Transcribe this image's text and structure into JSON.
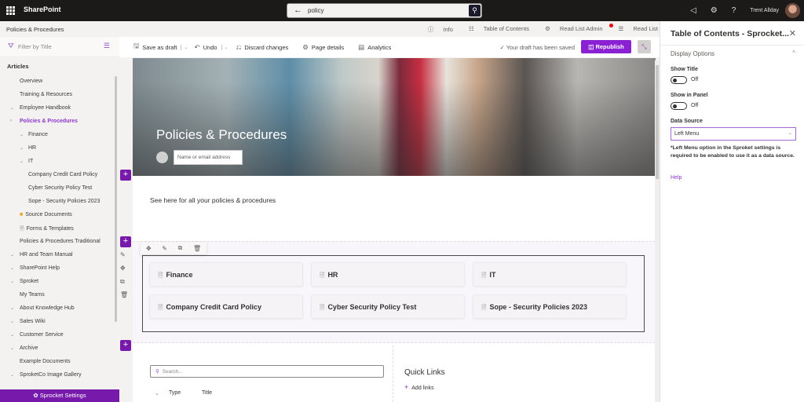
{
  "topbar": {
    "app_name": "SharePoint",
    "search_value": "policy",
    "user_name": "Trent Allday",
    "icons": [
      "waffle-icon",
      "back-arrow-icon",
      "search-icon",
      "megaphone-icon",
      "gear-icon",
      "help-icon",
      "avatar"
    ]
  },
  "sitebar": {
    "site_name": "Policies & Procedures",
    "commands": [
      {
        "icon": "ⓘ",
        "label": "Info"
      },
      {
        "icon": "☷",
        "label": "Table of Contents"
      },
      {
        "icon": "⚙",
        "label": "Read List Admin"
      },
      {
        "icon": "☰",
        "label": "Read List"
      }
    ]
  },
  "leftnav": {
    "filter_placeholder": "Filter by Title",
    "heading": "Articles",
    "items": [
      {
        "label": "Overview",
        "level": 0,
        "chevron": ""
      },
      {
        "label": "Training & Resources",
        "level": 0,
        "chevron": ""
      },
      {
        "label": "Employee Handbook",
        "level": 0,
        "chevron": "⌄"
      },
      {
        "label": "Policies & Procedures",
        "level": 0,
        "chevron": "›",
        "active": true
      },
      {
        "label": "Finance",
        "level": 1,
        "chevron": "⌄"
      },
      {
        "label": "HR",
        "level": 1,
        "chevron": "⌄"
      },
      {
        "label": "IT",
        "level": 1,
        "chevron": "⌄"
      },
      {
        "label": "Company Credit Card Policy",
        "level": 2,
        "chevron": ""
      },
      {
        "label": "Cyber Security Policy Test",
        "level": 2,
        "chevron": ""
      },
      {
        "label": "Sope - Security Policies 2023",
        "level": 2,
        "chevron": ""
      },
      {
        "label": "Source Documents",
        "level": 1,
        "chevron": "",
        "icon": "folder"
      },
      {
        "label": "Forms & Templates",
        "level": 1,
        "chevron": "",
        "icon": "doc"
      },
      {
        "label": "Policies & Procedures Traditional",
        "level": 0,
        "chevron": ""
      },
      {
        "label": "HR and Team Manual",
        "level": 0,
        "chevron": "⌄"
      },
      {
        "label": "SharePoint Help",
        "level": 0,
        "chevron": "⌄"
      },
      {
        "label": "Sproket",
        "level": 0,
        "chevron": "⌄"
      },
      {
        "label": "My Teams",
        "level": 0,
        "chevron": ""
      },
      {
        "label": "About Knowledge Hub",
        "level": 0,
        "chevron": "⌄"
      },
      {
        "label": "Sales Wiki",
        "level": 0,
        "chevron": "⌄"
      },
      {
        "label": "Customer Service",
        "level": 0,
        "chevron": "⌄"
      },
      {
        "label": "Archive",
        "level": 0,
        "chevron": "⌄"
      },
      {
        "label": "Example Documents",
        "level": 0,
        "chevron": ""
      },
      {
        "label": "SproketCo Image Gallery",
        "level": 0,
        "chevron": "⌄"
      }
    ],
    "settings_label": "Sprocket Settings"
  },
  "toolbar": {
    "save_draft": "Save as draft",
    "undo": "Undo",
    "discard": "Discard changes",
    "page_details": "Page details",
    "analytics": "Analytics",
    "status": "Your draft has been saved",
    "republish": "Republish"
  },
  "page": {
    "title": "Policies & Procedures",
    "author_placeholder": "Name or email address",
    "intro": "See here for all your policies & procedures",
    "toc_cards": [
      "Finance",
      "HR",
      "IT",
      "Company Credit Card Policy",
      "Cyber Security Policy Test",
      "Sope - Security Policies 2023"
    ],
    "list_search_placeholder": "Search...",
    "list_columns": [
      "Type",
      "Title"
    ],
    "quick_links_title": "Quick Links",
    "add_links": "Add links"
  },
  "rpanel": {
    "title": "Table of Contents - Sprocket...",
    "section": "Display Options",
    "show_title_label": "Show Title",
    "show_title_state": "Off",
    "show_in_panel_label": "Show in Panel",
    "show_in_panel_state": "Off",
    "data_source_label": "Data Source",
    "data_source_value": "Left Menu",
    "note": "*Left Menu option in the Sproket settings is required to be enabled to use it as a data source.",
    "help": "Help"
  },
  "colors": {
    "accent": "#8a22d3",
    "brand_purple": "#7719aa",
    "topbar": "#1b1a19"
  }
}
